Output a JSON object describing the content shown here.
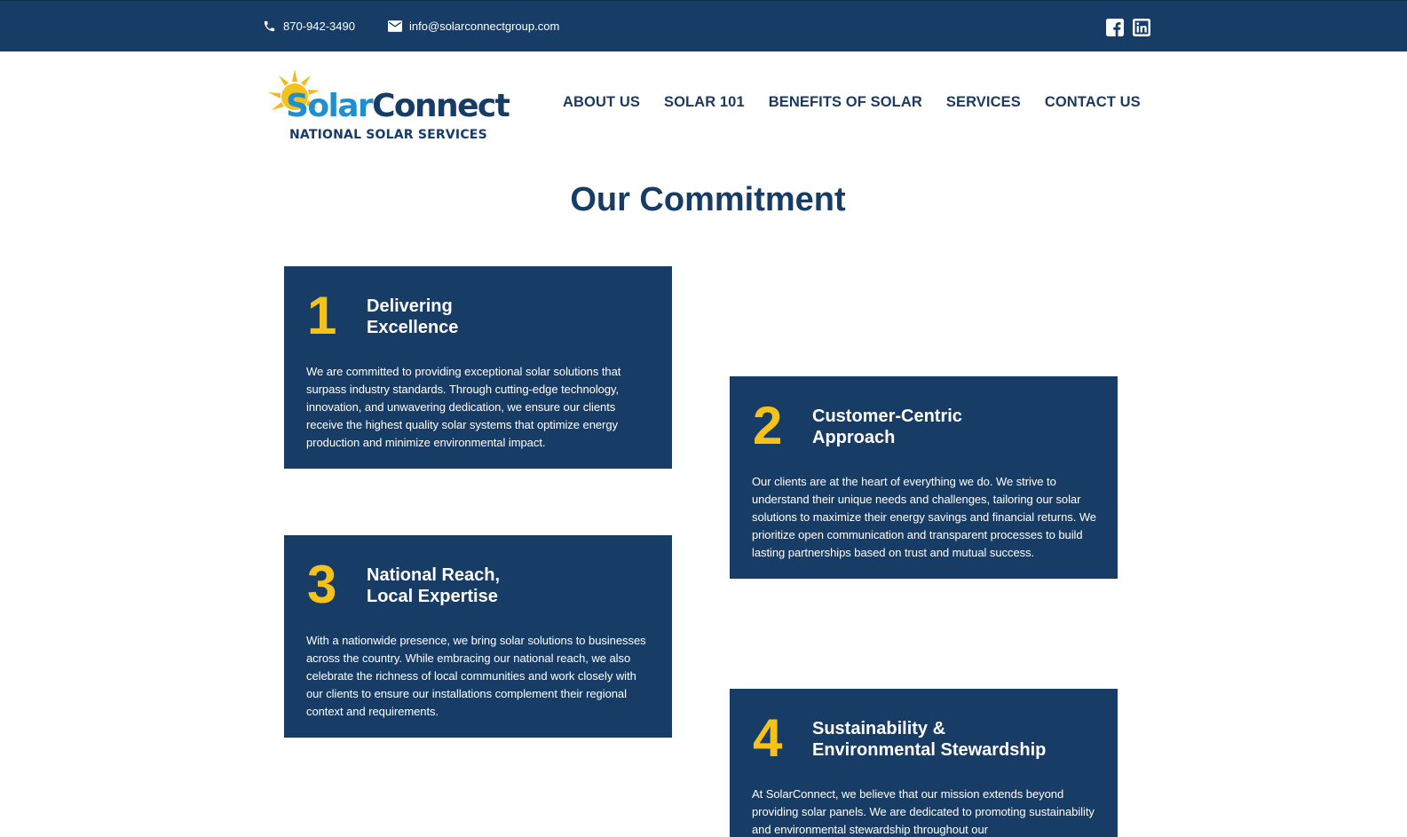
{
  "topbar": {
    "phone": "870-942-3490",
    "email": "info@solarconnectgroup.com",
    "phone_icon": "phone-icon",
    "email_icon": "envelope-icon",
    "social": [
      "facebook-icon",
      "linkedin-icon"
    ]
  },
  "logo": {
    "word_solar": "Solar",
    "word_connect": "Connect",
    "subtitle": "NATIONAL SOLAR SERVICES"
  },
  "nav": {
    "items": [
      "ABOUT US",
      "SOLAR 101",
      "BENEFITS OF SOLAR",
      "SERVICES",
      "CONTACT US"
    ]
  },
  "page": {
    "heading": "Our Commitment"
  },
  "cards": [
    {
      "number": "1",
      "title_line1": "Delivering",
      "title_line2": "Excellence",
      "body": "We are committed to providing exceptional solar solutions that surpass industry standards. Through cutting-edge technology, innovation, and unwavering dedication, we ensure our clients receive the highest quality solar systems that optimize energy production and minimize environmental impact."
    },
    {
      "number": "2",
      "title_line1": "Customer-Centric",
      "title_line2": "Approach",
      "body": "Our clients are at the heart of everything we do. We strive to understand their unique needs and challenges, tailoring our solar solutions to maximize their energy savings and financial returns. We prioritize open communication and transparent processes to build lasting partnerships based on trust and mutual success."
    },
    {
      "number": "3",
      "title_line1": "National Reach,",
      "title_line2": "Local Expertise",
      "body": "With a nationwide presence, we bring solar solutions to businesses across the country. While embracing our national reach, we also celebrate the richness of local communities and work closely with our clients to ensure our installations complement their regional context and requirements."
    },
    {
      "number": "4",
      "title_line1": "Sustainability &",
      "title_line2": "Environmental Stewardship",
      "body": "At SolarConnect, we believe that our mission extends beyond providing solar panels. We are dedicated to promoting sustainability and environmental stewardship throughout our"
    }
  ],
  "colors": {
    "navy": "#173c65",
    "gold": "#f5c21b",
    "logo_blue": "#1f8fd0"
  }
}
